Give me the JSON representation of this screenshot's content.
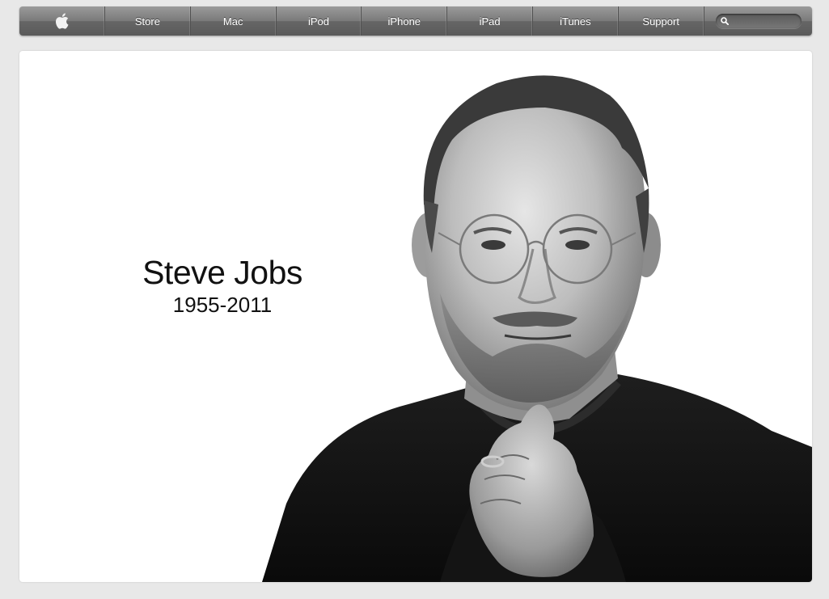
{
  "nav": {
    "items": [
      {
        "label": "Store",
        "name": "nav-store"
      },
      {
        "label": "Mac",
        "name": "nav-mac"
      },
      {
        "label": "iPod",
        "name": "nav-ipod"
      },
      {
        "label": "iPhone",
        "name": "nav-iphone"
      },
      {
        "label": "iPad",
        "name": "nav-ipad"
      },
      {
        "label": "iTunes",
        "name": "nav-itunes"
      },
      {
        "label": "Support",
        "name": "nav-support"
      }
    ],
    "search_placeholder": ""
  },
  "hero": {
    "name": "Steve Jobs",
    "years": "1955-2011"
  }
}
